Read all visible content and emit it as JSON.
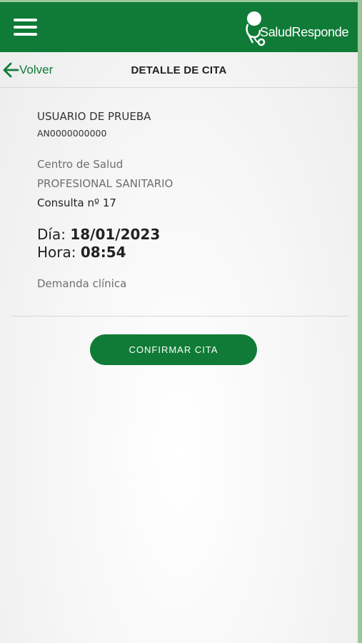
{
  "header": {
    "menu_icon": "hamburger-menu-icon",
    "logo_text": "SaludResponde",
    "logo_icon": "stethoscope-icon",
    "brand_color": "#107b37"
  },
  "nav": {
    "back_icon": "arrow-left-icon",
    "back_label": "Volver",
    "title": "DETALLE DE CITA"
  },
  "appointment": {
    "user_name": "USUARIO DE PRUEBA",
    "user_id": "AN0000000000",
    "center": "Centro de Salud",
    "professional": "PROFESIONAL SANITARIO",
    "consulta": "Consulta nº 17",
    "date_label": "Día:",
    "date_value": "18/01/2023",
    "time_label": "Hora:",
    "time_value": "08:54",
    "reason": "Demanda clínica"
  },
  "actions": {
    "confirm_label": "CONFIRMAR CITA"
  }
}
